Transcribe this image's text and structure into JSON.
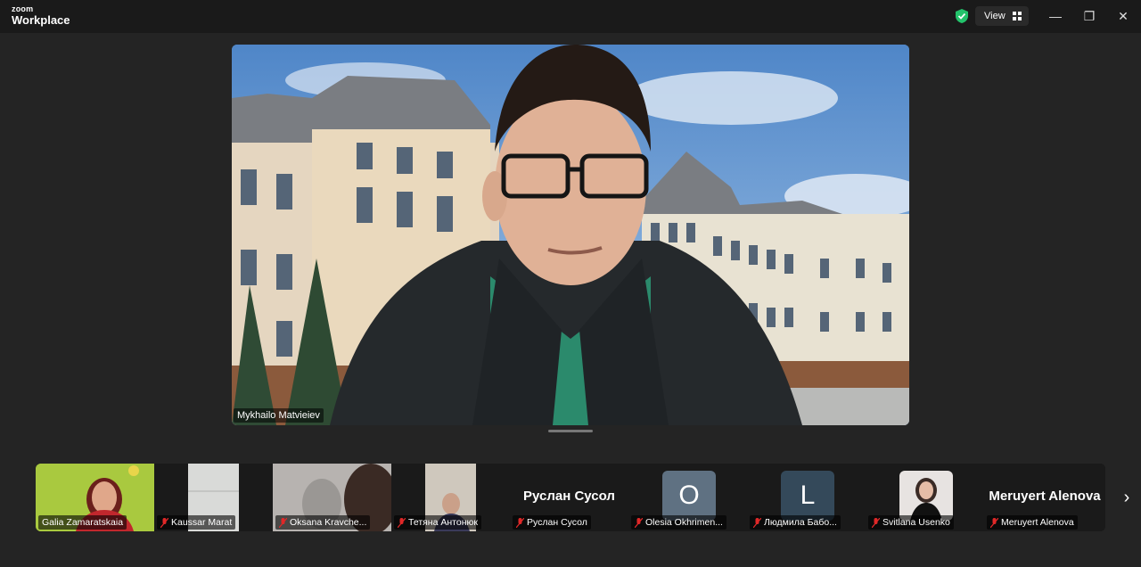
{
  "app": {
    "brand_top": "zoom",
    "brand_bottom": "Workplace"
  },
  "toolbar": {
    "view_label": "View"
  },
  "window_controls": {
    "minimize": "—",
    "restore": "❐",
    "close": "✕"
  },
  "speaker": {
    "name": "Mykhailo Matvieiev"
  },
  "participants": [
    {
      "name": "Galia Zamaratskaia",
      "muted": false,
      "type": "video"
    },
    {
      "name": "Kaussar Marat",
      "muted": true,
      "type": "video"
    },
    {
      "name": "Oksana Kravche...",
      "muted": true,
      "type": "video"
    },
    {
      "name": "Тетяна Антонюк",
      "muted": true,
      "type": "video"
    },
    {
      "name": "Руслан Сусол",
      "muted": true,
      "type": "name",
      "display": "Руслан Сусол"
    },
    {
      "name": "Olesia Okhrimen...",
      "muted": true,
      "type": "letter",
      "letter": "O",
      "color": "#5f7182"
    },
    {
      "name": "Людмила Бабо...",
      "muted": true,
      "type": "letter",
      "letter": "L",
      "color": "#34495a"
    },
    {
      "name": "Svitlana Usenko",
      "muted": true,
      "type": "video"
    },
    {
      "name": "Meruyert Alenova",
      "muted": true,
      "type": "name",
      "display": "Meruyert Alenova"
    }
  ],
  "next_icon": "›"
}
